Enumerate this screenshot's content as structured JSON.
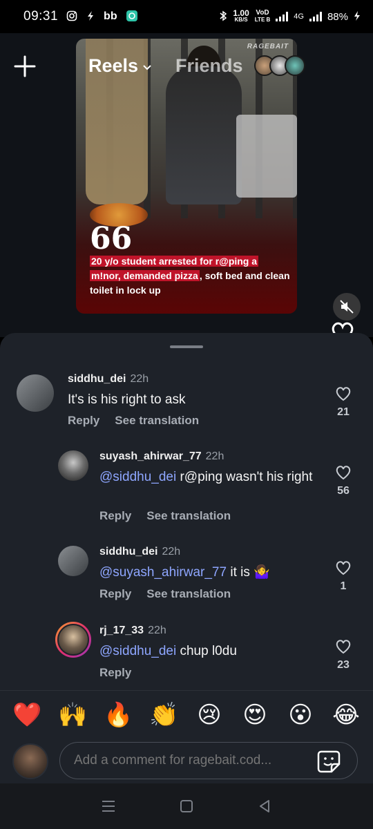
{
  "status_bar": {
    "time": "09:31",
    "speed_value": "1.00",
    "speed_unit": "KB/S",
    "volte_top": "VoD",
    "volte_bottom": "LTE B",
    "network": "4G",
    "battery": "88%"
  },
  "reel": {
    "tabs": {
      "reels": "Reels",
      "friends": "Friends"
    },
    "watermark": "RAGEBAIT",
    "quote": "66",
    "caption_highlight_1": "20 y/o student arrested for r@ping a",
    "caption_highlight_2": "m!nor,  demanded pizza",
    "caption_rest": ", soft bed and clean toilet in lock up"
  },
  "comments": [
    {
      "username": "siddhu_dei",
      "time": "22h",
      "mention": "",
      "text": "It's is his right to ask",
      "reply": "Reply",
      "translate": "See translation",
      "likes": "21"
    },
    {
      "username": "suyash_ahirwar_77",
      "time": "22h",
      "mention": "@siddhu_dei",
      "text": " r@ping wasn't his right",
      "reply": "Reply",
      "translate": "See translation",
      "likes": "56"
    },
    {
      "username": "siddhu_dei",
      "time": "22h",
      "mention": "@suyash_ahirwar_77",
      "text": " it is 🤷‍♀️",
      "reply": "Reply",
      "translate": "See translation",
      "likes": "1"
    },
    {
      "username": "rj_17_33",
      "time": "22h",
      "mention": "@siddhu_dei",
      "text": " chup l0du",
      "reply": "Reply",
      "likes": "23"
    }
  ],
  "emoji_reactions": [
    "❤️",
    "🙌",
    "🔥",
    "👏",
    "😢",
    "😍",
    "😮",
    "😂"
  ],
  "composer": {
    "placeholder": "Add a comment for ragebait.cod..."
  },
  "colors": {
    "sheet_bg": "#1e2229",
    "mention": "#8ea6ff",
    "highlight": "#c0142a"
  }
}
